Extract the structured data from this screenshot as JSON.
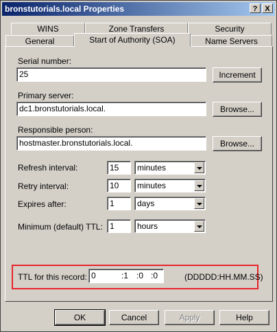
{
  "window": {
    "title": "bronstutorials.local Properties",
    "help_btn": "?",
    "close_btn": "X"
  },
  "tabs": {
    "row1": [
      "WINS",
      "Zone Transfers",
      "Security"
    ],
    "row2": [
      "General",
      "Start of Authority (SOA)",
      "Name Servers"
    ],
    "active": "Start of Authority (SOA)"
  },
  "soa": {
    "serial_label": "Serial number:",
    "serial_value": "25",
    "increment_btn": "Increment",
    "primary_label": "Primary server:",
    "primary_value": "dc1.bronstutorials.local.",
    "browse_btn": "Browse...",
    "responsible_label": "Responsible person:",
    "responsible_value": "hostmaster.bronstutorials.local.",
    "refresh_label": "Refresh interval:",
    "refresh_value": "15",
    "refresh_unit": "minutes",
    "retry_label": "Retry interval:",
    "retry_value": "10",
    "retry_unit": "minutes",
    "expires_label": "Expires after:",
    "expires_value": "1",
    "expires_unit": "days",
    "minttl_label": "Minimum (default) TTL:",
    "minttl_value": "1",
    "minttl_unit": "hours",
    "ttl_label": "TTL for this record:",
    "ttl_days": "0",
    "ttl_hours": ":1",
    "ttl_minutes": ":0",
    "ttl_seconds": ":0",
    "ttl_format": "(DDDDD:HH.MM.SS)"
  },
  "footer": {
    "ok": "OK",
    "cancel": "Cancel",
    "apply": "Apply",
    "help": "Help"
  },
  "colors": {
    "face": "#d4d0c8",
    "highlight_box": "#e8232a",
    "title_start": "#0a246a"
  }
}
